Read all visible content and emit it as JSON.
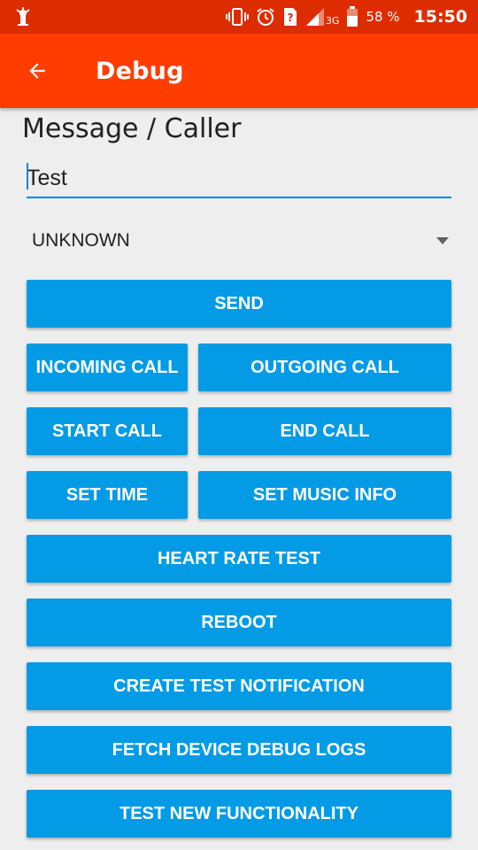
{
  "status_bar": {
    "battery_percent": "58 %",
    "network": "3G",
    "time": "15:50",
    "icons": [
      "app-notification-icon",
      "vibrate-icon",
      "alarm-icon",
      "sim-unknown-icon",
      "signal-icon",
      "battery-icon"
    ]
  },
  "app_bar": {
    "title": "Debug",
    "back_icon": "arrow-back-icon"
  },
  "colors": {
    "status_bar": "#dd2c00",
    "app_bar": "#ff3d00",
    "button": "#039be5",
    "accent": "#0288d1",
    "background": "#eeeeee"
  },
  "form": {
    "section_title": "Message / Caller",
    "message_value": "Test",
    "spinner_value": "UNKNOWN"
  },
  "buttons": {
    "send": "SEND",
    "incoming_call": "INCOMING CALL",
    "outgoing_call": "OUTGOING CALL",
    "start_call": "START CALL",
    "end_call": "END CALL",
    "set_time": "SET TIME",
    "set_music_info": "SET MUSIC INFO",
    "heart_rate_test": "HEART RATE TEST",
    "reboot": "REBOOT",
    "create_test_notification": "CREATE TEST NOTIFICATION",
    "fetch_device_debug_logs": "FETCH DEVICE DEBUG LOGS",
    "test_new_functionality": "TEST NEW FUNCTIONALITY"
  }
}
